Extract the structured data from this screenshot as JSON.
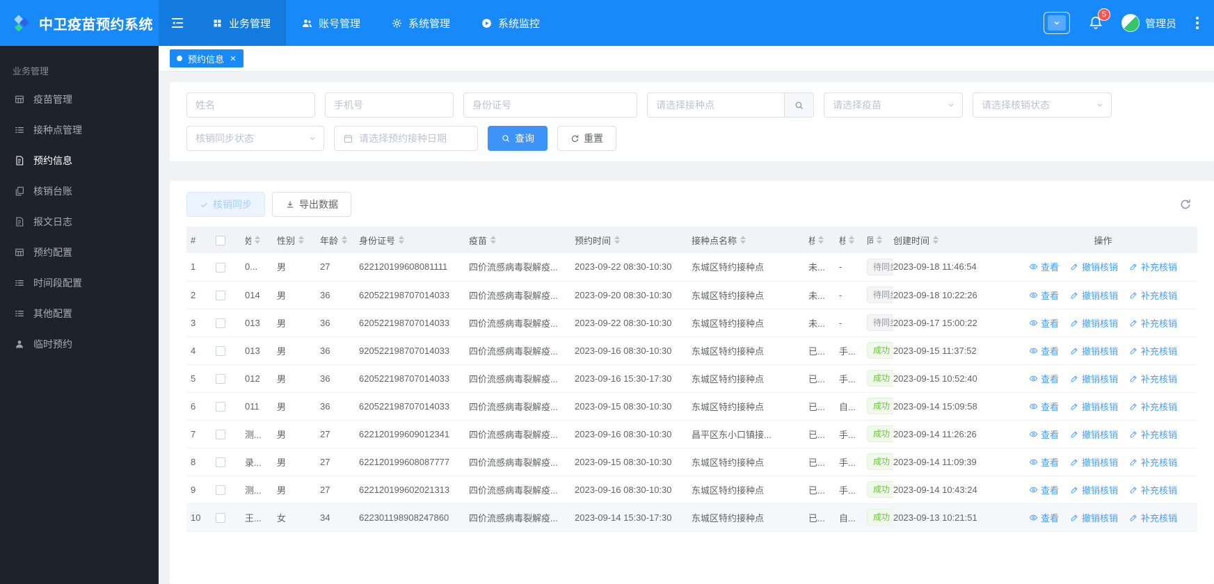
{
  "app": {
    "title": "中卫疫苗预约系统"
  },
  "navbar": {
    "menu": [
      {
        "label": "业务管理",
        "icon": "grid-icon",
        "active": true
      },
      {
        "label": "账号管理",
        "icon": "users-icon",
        "active": false
      },
      {
        "label": "系统管理",
        "icon": "gear-icon",
        "active": false
      },
      {
        "label": "系统监控",
        "icon": "monitor-icon",
        "active": false
      }
    ],
    "notification_count": "5",
    "user_name": "管理员"
  },
  "sidebar": {
    "section_label": "业务管理",
    "items": [
      {
        "label": "疫苗管理",
        "icon": "table-icon",
        "active": false
      },
      {
        "label": "接种点管理",
        "icon": "list-icon",
        "active": false
      },
      {
        "label": "预约信息",
        "icon": "document-icon",
        "active": true
      },
      {
        "label": "核销台账",
        "icon": "copy-icon",
        "active": false
      },
      {
        "label": "报文日志",
        "icon": "document-icon",
        "active": false
      },
      {
        "label": "预约配置",
        "icon": "table-icon",
        "active": false
      },
      {
        "label": "时间段配置",
        "icon": "list-icon",
        "active": false
      },
      {
        "label": "其他配置",
        "icon": "list-icon",
        "active": false
      },
      {
        "label": "临时预约",
        "icon": "user-icon",
        "active": false
      }
    ]
  },
  "tabbar": {
    "tabs": [
      {
        "label": "预约信息",
        "active": true
      }
    ]
  },
  "filters": {
    "name_placeholder": "姓名",
    "phone_placeholder": "手机号",
    "idcard_placeholder": "身份证号",
    "site_placeholder": "请选择接种点",
    "vaccine_placeholder": "请选择疫苗",
    "status_placeholder": "请选择核销状态",
    "sync_placeholder": "核销同步状态",
    "date_placeholder": "请选择预约接种日期",
    "search_label": "查询",
    "reset_label": "重置"
  },
  "toolbar": {
    "sync_label": "核销同步",
    "export_label": "导出数据"
  },
  "table": {
    "columns": [
      {
        "key": "index",
        "label": "#",
        "sortable": false
      },
      {
        "key": "checkbox",
        "label": "",
        "sortable": false
      },
      {
        "key": "name",
        "label": "姓名",
        "sortable": true,
        "clip": true
      },
      {
        "key": "gender",
        "label": "性别",
        "sortable": true
      },
      {
        "key": "age",
        "label": "年龄",
        "sortable": true
      },
      {
        "key": "idcard",
        "label": "身份证号",
        "sortable": true
      },
      {
        "key": "vaccine",
        "label": "疫苗",
        "sortable": true
      },
      {
        "key": "appt_time",
        "label": "预约时间",
        "sortable": true
      },
      {
        "key": "site",
        "label": "接种点名称",
        "sortable": true
      },
      {
        "key": "verify_status",
        "label": "核销状态",
        "sortable": true,
        "clip": true
      },
      {
        "key": "verify_method",
        "label": "核销方式",
        "sortable": true,
        "clip": true
      },
      {
        "key": "sync_status",
        "label": "同步状态",
        "sortable": true,
        "clip": true
      },
      {
        "key": "created",
        "label": "创建时间",
        "sortable": true
      },
      {
        "key": "actions",
        "label": "操作",
        "sortable": false
      }
    ],
    "actions": [
      {
        "label": "查看",
        "icon": "eye-icon"
      },
      {
        "label": "撤销核销",
        "icon": "edit-icon"
      },
      {
        "label": "补充核销",
        "icon": "edit-icon"
      }
    ],
    "rows": [
      {
        "index": "1",
        "name": "0...",
        "gender": "男",
        "age": "27",
        "idcard": "622120199608081111",
        "vaccine": "四价流感病毒裂解疫...",
        "appt_time": "2023-09-22 08:30-10:30",
        "site": "东城区特约接种点",
        "verify_status": "未...",
        "verify_method": "-",
        "sync_status": "待同步",
        "sync_state": "info",
        "created": "2023-09-18 11:46:54",
        "highlight": false
      },
      {
        "index": "2",
        "name": "014",
        "gender": "男",
        "age": "36",
        "idcard": "620522198707014033",
        "vaccine": "四价流感病毒裂解疫...",
        "appt_time": "2023-09-20 08:30-10:30",
        "site": "东城区特约接种点",
        "verify_status": "未...",
        "verify_method": "-",
        "sync_status": "待同步",
        "sync_state": "info",
        "created": "2023-09-18 10:22:26",
        "highlight": false
      },
      {
        "index": "3",
        "name": "013",
        "gender": "男",
        "age": "36",
        "idcard": "620522198707014033",
        "vaccine": "四价流感病毒裂解疫...",
        "appt_time": "2023-09-22 08:30-10:30",
        "site": "东城区特约接种点",
        "verify_status": "未...",
        "verify_method": "-",
        "sync_status": "待同步",
        "sync_state": "info",
        "created": "2023-09-17 15:00:22",
        "highlight": false
      },
      {
        "index": "4",
        "name": "013",
        "gender": "男",
        "age": "36",
        "idcard": "920522198707014033",
        "vaccine": "四价流感病毒裂解疫...",
        "appt_time": "2023-09-16 08:30-10:30",
        "site": "东城区特约接种点",
        "verify_status": "已...",
        "verify_method": "手...",
        "sync_status": "成功",
        "sync_state": "success",
        "created": "2023-09-15 11:37:52",
        "highlight": false
      },
      {
        "index": "5",
        "name": "012",
        "gender": "男",
        "age": "36",
        "idcard": "620522198707014033",
        "vaccine": "四价流感病毒裂解疫...",
        "appt_time": "2023-09-16 15:30-17:30",
        "site": "东城区特约接种点",
        "verify_status": "已...",
        "verify_method": "手...",
        "sync_status": "成功",
        "sync_state": "success",
        "created": "2023-09-15 10:52:40",
        "highlight": false
      },
      {
        "index": "6",
        "name": "011",
        "gender": "男",
        "age": "36",
        "idcard": "620522198707014033",
        "vaccine": "四价流感病毒裂解疫...",
        "appt_time": "2023-09-15 08:30-10:30",
        "site": "东城区特约接种点",
        "verify_status": "已...",
        "verify_method": "自...",
        "sync_status": "成功",
        "sync_state": "success",
        "created": "2023-09-14 15:09:58",
        "highlight": false
      },
      {
        "index": "7",
        "name": "测...",
        "gender": "男",
        "age": "27",
        "idcard": "622120199609012341",
        "vaccine": "四价流感病毒裂解疫...",
        "appt_time": "2023-09-16 08:30-10:30",
        "site": "昌平区东小口镇接...",
        "verify_status": "已...",
        "verify_method": "手...",
        "sync_status": "成功",
        "sync_state": "success",
        "created": "2023-09-14 11:26:26",
        "highlight": false
      },
      {
        "index": "8",
        "name": "录...",
        "gender": "男",
        "age": "27",
        "idcard": "622120199608087777",
        "vaccine": "四价流感病毒裂解疫...",
        "appt_time": "2023-09-15 08:30-10:30",
        "site": "东城区特约接种点",
        "verify_status": "已...",
        "verify_method": "手...",
        "sync_status": "成功",
        "sync_state": "success",
        "created": "2023-09-14 11:09:39",
        "highlight": false
      },
      {
        "index": "9",
        "name": "测...",
        "gender": "男",
        "age": "27",
        "idcard": "622120199602021313",
        "vaccine": "四价流感病毒裂解疫...",
        "appt_time": "2023-09-16 08:30-10:30",
        "site": "东城区特约接种点",
        "verify_status": "已...",
        "verify_method": "手...",
        "sync_status": "成功",
        "sync_state": "success",
        "created": "2023-09-14 10:43:24",
        "highlight": false
      },
      {
        "index": "10",
        "name": "王...",
        "gender": "女",
        "age": "34",
        "idcard": "622301198908247860",
        "vaccine": "四价流感病毒裂解疫...",
        "appt_time": "2023-09-14 15:30-17:30",
        "site": "东城区特约接种点",
        "verify_status": "已...",
        "verify_method": "自...",
        "sync_status": "成功",
        "sync_state": "success",
        "created": "2023-09-13 10:21:51",
        "highlight": true
      }
    ]
  },
  "colors": {
    "navbar": "#1789f8",
    "sidebar": "#1e222b",
    "link": "#409eff",
    "tag_success_text": "#67c23a",
    "tag_info_text": "#909399",
    "badge_red": "#f5564e"
  }
}
